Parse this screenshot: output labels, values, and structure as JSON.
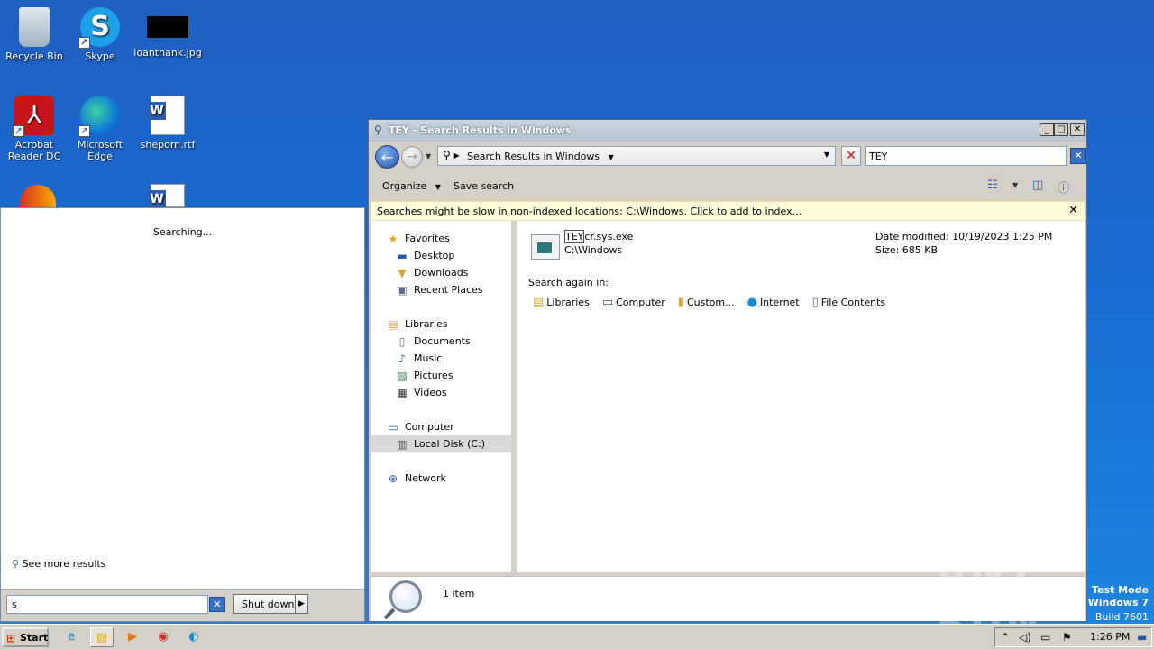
{
  "desktop": {
    "icons": [
      {
        "label": "Recycle Bin"
      },
      {
        "label": "Skype"
      },
      {
        "label": "loanthank.jpg"
      },
      {
        "label": "Acrobat Reader DC"
      },
      {
        "label": "Microsoft Edge"
      },
      {
        "label": "sheporn.rtf"
      }
    ]
  },
  "startmenu": {
    "status": "Searching...",
    "see_more": "See more results",
    "search_value": "s",
    "shutdown_label": "Shut down"
  },
  "explorer": {
    "title": "TEY - Search Results in Windows",
    "address": "Search Results in Windows",
    "search_value": "TEY",
    "toolbar": {
      "organize": "Organize",
      "save_search": "Save search"
    },
    "infobar": "Searches might be slow in non-indexed locations: C:\\Windows. Click to add to index...",
    "nav": {
      "favorites": "Favorites",
      "desktop": "Desktop",
      "downloads": "Downloads",
      "recent": "Recent Places",
      "libraries": "Libraries",
      "documents": "Documents",
      "music": "Music",
      "pictures": "Pictures",
      "videos": "Videos",
      "computer": "Computer",
      "localdisk": "Local Disk (C:)",
      "network": "Network"
    },
    "result": {
      "name_highlight": "TEY",
      "name_rest": "cr.sys.exe",
      "path": "C:\\Windows",
      "date_modified": "Date modified: 10/19/2023 1:25 PM",
      "size": "Size: 685 KB"
    },
    "search_again_label": "Search again in:",
    "search_again": {
      "libraries": "Libraries",
      "computer": "Computer",
      "custom": "Custom...",
      "internet": "Internet",
      "file_contents": "File Contents"
    },
    "details_count": "1 item"
  },
  "taskbar": {
    "start": "Start",
    "clock": "1:26 PM"
  },
  "watermark": "ANY RUN",
  "testmode": {
    "line1": "Test Mode",
    "line2": "Windows 7",
    "line3": "Build 7601"
  }
}
